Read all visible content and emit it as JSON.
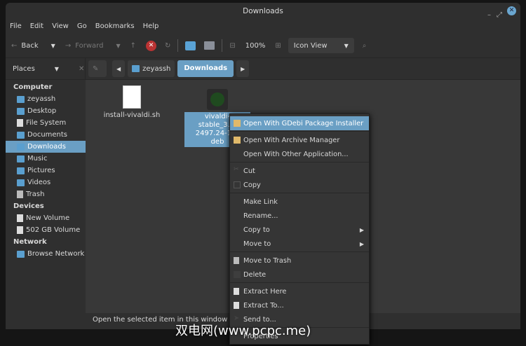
{
  "window": {
    "title": "Downloads"
  },
  "menubar": [
    "File",
    "Edit",
    "View",
    "Go",
    "Bookmarks",
    "Help"
  ],
  "toolbar": {
    "back": "Back",
    "forward": "Forward",
    "zoom": "100%",
    "view_mode": "Icon View"
  },
  "location": {
    "places_label": "Places",
    "crumbs": [
      "zeyassh",
      "Downloads"
    ]
  },
  "sidebar": {
    "computer": "Computer",
    "computer_items": [
      "zeyassh",
      "Desktop",
      "File System",
      "Documents",
      "Downloads",
      "Music",
      "Pictures",
      "Videos",
      "Trash"
    ],
    "devices": "Devices",
    "device_items": [
      "New Volume",
      "502 GB Volume"
    ],
    "network": "Network",
    "network_items": [
      "Browse Network"
    ]
  },
  "files": [
    {
      "name": "install-vivaldi.sh"
    },
    {
      "name_lines": [
        "vivaldi-stable_3.6.",
        "2497.24-1_a",
        "deb"
      ]
    }
  ],
  "status": "Open the selected item in this window",
  "context_menu": [
    "Open With GDebi Package Installer",
    "Open With Archive Manager",
    "Open With Other Application...",
    "Cut",
    "Copy",
    "Make Link",
    "Rename...",
    "Copy to",
    "Move to",
    "Move to Trash",
    "Delete",
    "Extract Here",
    "Extract To...",
    "Send to...",
    "Properties"
  ],
  "watermark": "双电网(www.pcpc.me)",
  "colors": {
    "accent": "#6a9fc4"
  }
}
